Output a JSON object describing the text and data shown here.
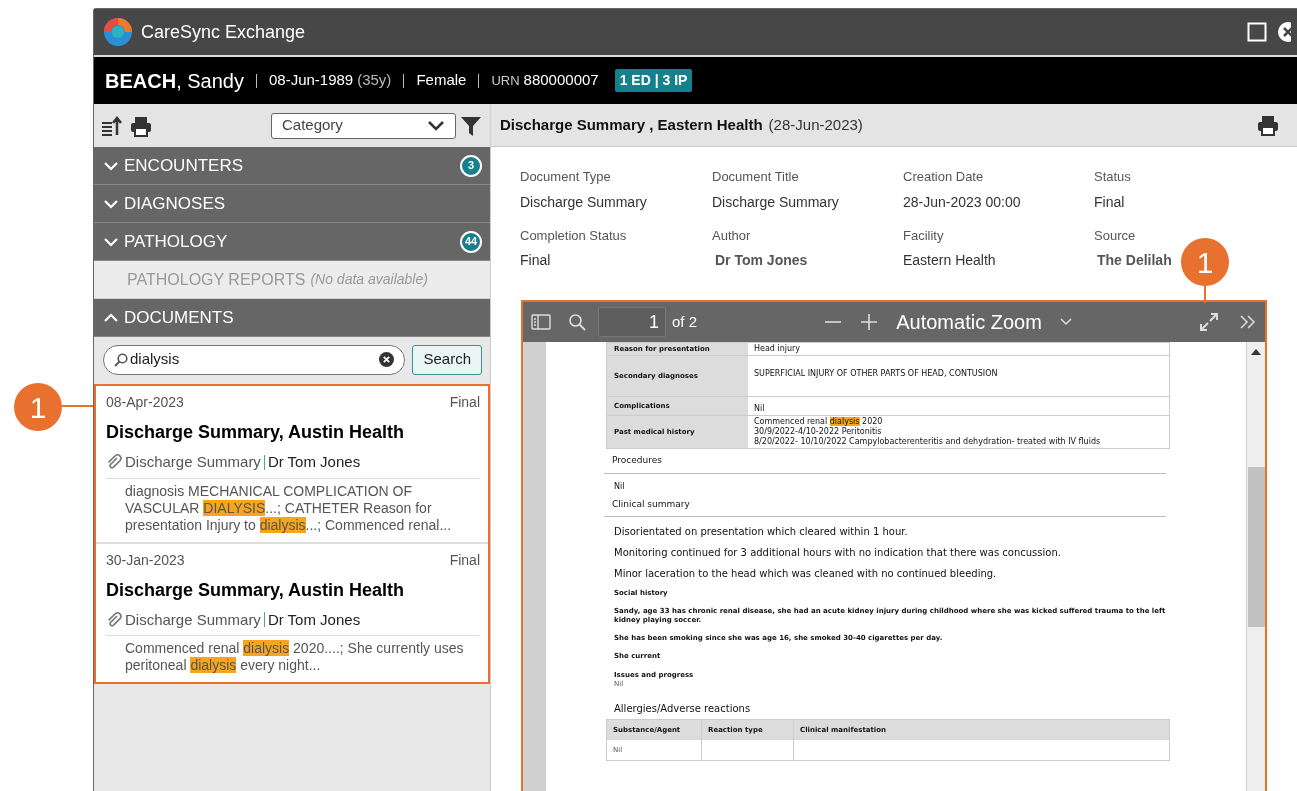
{
  "window": {
    "title": "CareSync Exchange"
  },
  "patient": {
    "name": "**BEACH**, Sandy",
    "dob": "08-Jun-1989",
    "age": "(35y)",
    "sex": "Female",
    "urn_label": "URN",
    "urn": "880000007",
    "badge": "1 ED | 3 IP"
  },
  "sidebar": {
    "category": {
      "placeholder": "Category"
    },
    "sections": [
      {
        "label": "ENCOUNTERS",
        "expanded": false,
        "count": "3"
      },
      {
        "label": "DIAGNOSES",
        "expanded": false
      },
      {
        "label": "PATHOLOGY",
        "expanded": false,
        "count": "44",
        "children": [
          {
            "label": "PATHOLOGY REPORTS",
            "note": "(No data available)"
          }
        ]
      },
      {
        "label": "DOCUMENTS",
        "expanded": true
      }
    ],
    "search": {
      "value": "dialysis",
      "button": "Search"
    },
    "results": [
      {
        "date": "08-Apr-2023",
        "status": "Final",
        "title": "Discharge Summary, Austin Health",
        "type": "Discharge Summary",
        "author": "Dr Tom Jones",
        "snippet": [
          {
            "text": "diagnosis MECHANICAL COMPLICATION OF VASCULAR "
          },
          {
            "text": "DIALYSIS",
            "highlighted": true
          },
          {
            "text": "...; CATHETER Reason for presentation Injury to "
          },
          {
            "text": "dialysis",
            "highlighted": true
          },
          {
            "text": "...; Commenced renal..."
          }
        ]
      },
      {
        "date": "30-Jan-2023",
        "status": "Final",
        "title": "Discharge Summary, Austin Health",
        "type": "Discharge Summary",
        "author": "Dr Tom Jones",
        "snippet": [
          {
            "text": "Commenced renal "
          },
          {
            "text": "dialysis",
            "highlighted": true
          },
          {
            "text": " 2020....; She currently uses peritoneal "
          },
          {
            "text": "dialysis",
            "highlighted": true
          },
          {
            "text": " every night..."
          }
        ]
      }
    ]
  },
  "document": {
    "title": "Discharge Summary , Eastern Health",
    "date": "(28-Jun-2023)",
    "fields": [
      {
        "label": "Document Type",
        "value": "Discharge Summary",
        "emphasis": false
      },
      {
        "label": "Document Title",
        "value": "Discharge Summary",
        "emphasis": false
      },
      {
        "label": "Creation Date",
        "value": "28-Jun-2023 00:00",
        "emphasis": false
      },
      {
        "label": "Status",
        "value": "Final",
        "emphasis": false
      },
      {
        "label": "Completion Status",
        "value": "Final",
        "emphasis": false
      },
      {
        "label": "Author",
        "value": "Dr Tom Jones",
        "emphasis": true
      },
      {
        "label": "Facility",
        "value": "Eastern Health",
        "emphasis": false
      },
      {
        "label": "Source",
        "value": "The Delilah",
        "emphasis": true
      }
    ]
  },
  "viewer": {
    "page": "1",
    "page_count": "of 2",
    "zoom": "Automatic Zoom",
    "content": [
      {
        "kind": "table",
        "rows": [
          {
            "label": "Reason for presentation",
            "lines": [
              "Head injury"
            ]
          },
          {
            "label": "Secondary diagnoses",
            "lines": [
              "SUPERFICIAL INJURY OF OTHER PARTS OF HEAD, CONTUSION"
            ]
          },
          {
            "label": "Complications",
            "lines": [
              "Nil"
            ]
          },
          {
            "label": "Past medical history",
            "lines": [
              [
                {
                  "text": "Commenced renal "
                },
                {
                  "text": "dialysis",
                  "highlighted": true
                },
                {
                  "text": " 2020"
                }
              ],
              "30/9/2022-4/10-2022 Peritonitis",
              "8/20/2022- 10/10/2022 Campylobacterenteritis and dehydration- treated with IV fluids"
            ]
          }
        ]
      },
      {
        "kind": "heading",
        "text": "Procedures"
      },
      {
        "kind": "text",
        "text": "Nil"
      },
      {
        "kind": "heading",
        "text": "Clinical summary"
      },
      {
        "kind": "paragraph",
        "text": "Disorientated on presentation which cleared within 1 hour."
      },
      {
        "kind": "paragraph",
        "text": "Monitoring continued for 3 additional hours with no indication that there was concussion."
      },
      {
        "kind": "paragraph",
        "text": "Minor laceration to the head which was cleaned with no continued bleeding."
      },
      {
        "kind": "bold",
        "text": "Social history"
      },
      {
        "kind": "bold",
        "text": "Sandy, age 33  has chronic renal disease, she had an acute kidney injury during childhood where she was kicked suffered trauma to the left kidney playing soccer."
      },
      {
        "kind": "bold",
        "text": "She has been smoking since she was age 16, she smoked 30-40 cigarettes per day."
      },
      {
        "kind": "bold",
        "text": "She current"
      },
      {
        "kind": "label",
        "text": "Issues and progress",
        "value": "Nil"
      },
      {
        "kind": "subtitle",
        "text": "Allergies/Adverse reactions"
      },
      {
        "kind": "grid",
        "columns": [
          "Substance/Agent",
          "Reaction type",
          "Clinical manifestation"
        ],
        "rows": [
          [
            "Nil"
          ]
        ]
      }
    ]
  },
  "callouts": [
    {
      "number": "1"
    },
    {
      "number": "1"
    }
  ]
}
